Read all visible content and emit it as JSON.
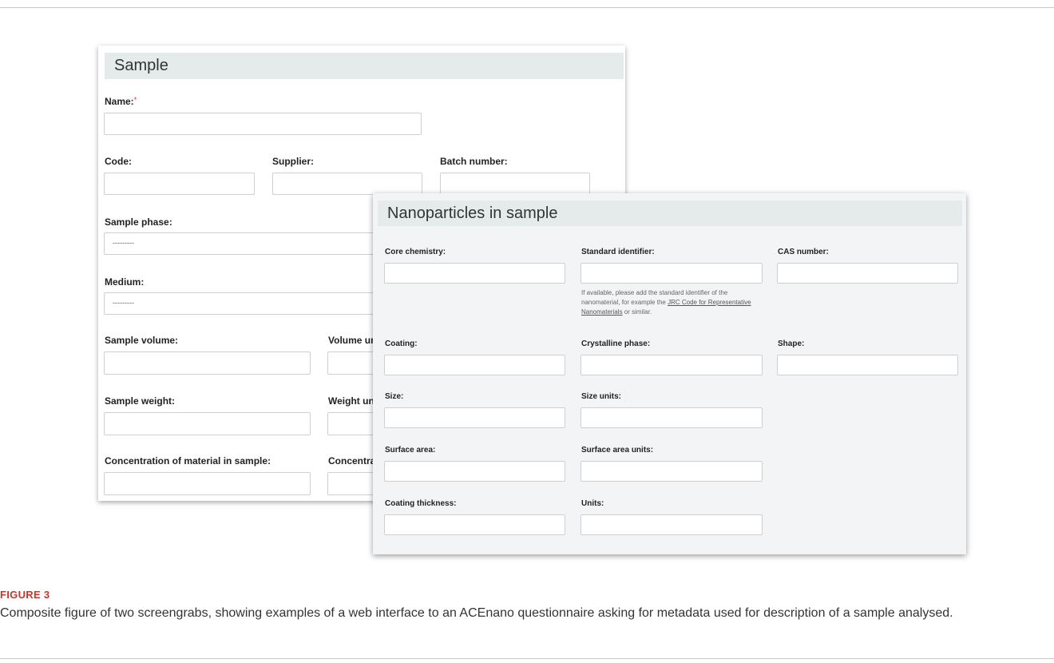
{
  "sample": {
    "title": "Sample",
    "name_label": "Name:",
    "required_mark": "*",
    "code_label": "Code:",
    "supplier_label": "Supplier:",
    "batch_label": "Batch number:",
    "phase_label": "Sample phase:",
    "phase_value": "---------",
    "medium_label": "Medium:",
    "medium_value": "---------",
    "volume_label": "Sample volume:",
    "volume_units_label": "Volume un",
    "weight_label": "Sample weight:",
    "weight_units_label": "Weight uni",
    "concentration_label": "Concentration of material in sample:",
    "concentration_units_label": "Concentrat"
  },
  "nano": {
    "title": "Nanoparticles in sample",
    "core_label": "Core chemistry:",
    "standard_label": "Standard identifier:",
    "cas_label": "CAS number:",
    "help_pre": "If available, please add the standard identifier of the nanomaterial, for example the ",
    "help_link": "JRC Code for Representative Nanomaterials",
    "help_post": " or similar.",
    "coating_label": "Coating:",
    "crystalline_label": "Crystalline phase:",
    "shape_label": "Shape:",
    "size_label": "Size:",
    "size_units_label": "Size units:",
    "surface_label": "Surface area:",
    "surface_units_label": "Surface area units:",
    "thickness_label": "Coating thickness:",
    "units_label": "Units:"
  },
  "caption": {
    "label": "FIGURE 3",
    "text": "Composite figure of two screengrabs, showing examples of a web interface to an ACEnano questionnaire asking for metadata used for description of a sample analysed."
  },
  "colors": {
    "header_bg": "#e4ebea",
    "caption_label": "#c0392b",
    "panel_bg": "#f3f4f6"
  }
}
